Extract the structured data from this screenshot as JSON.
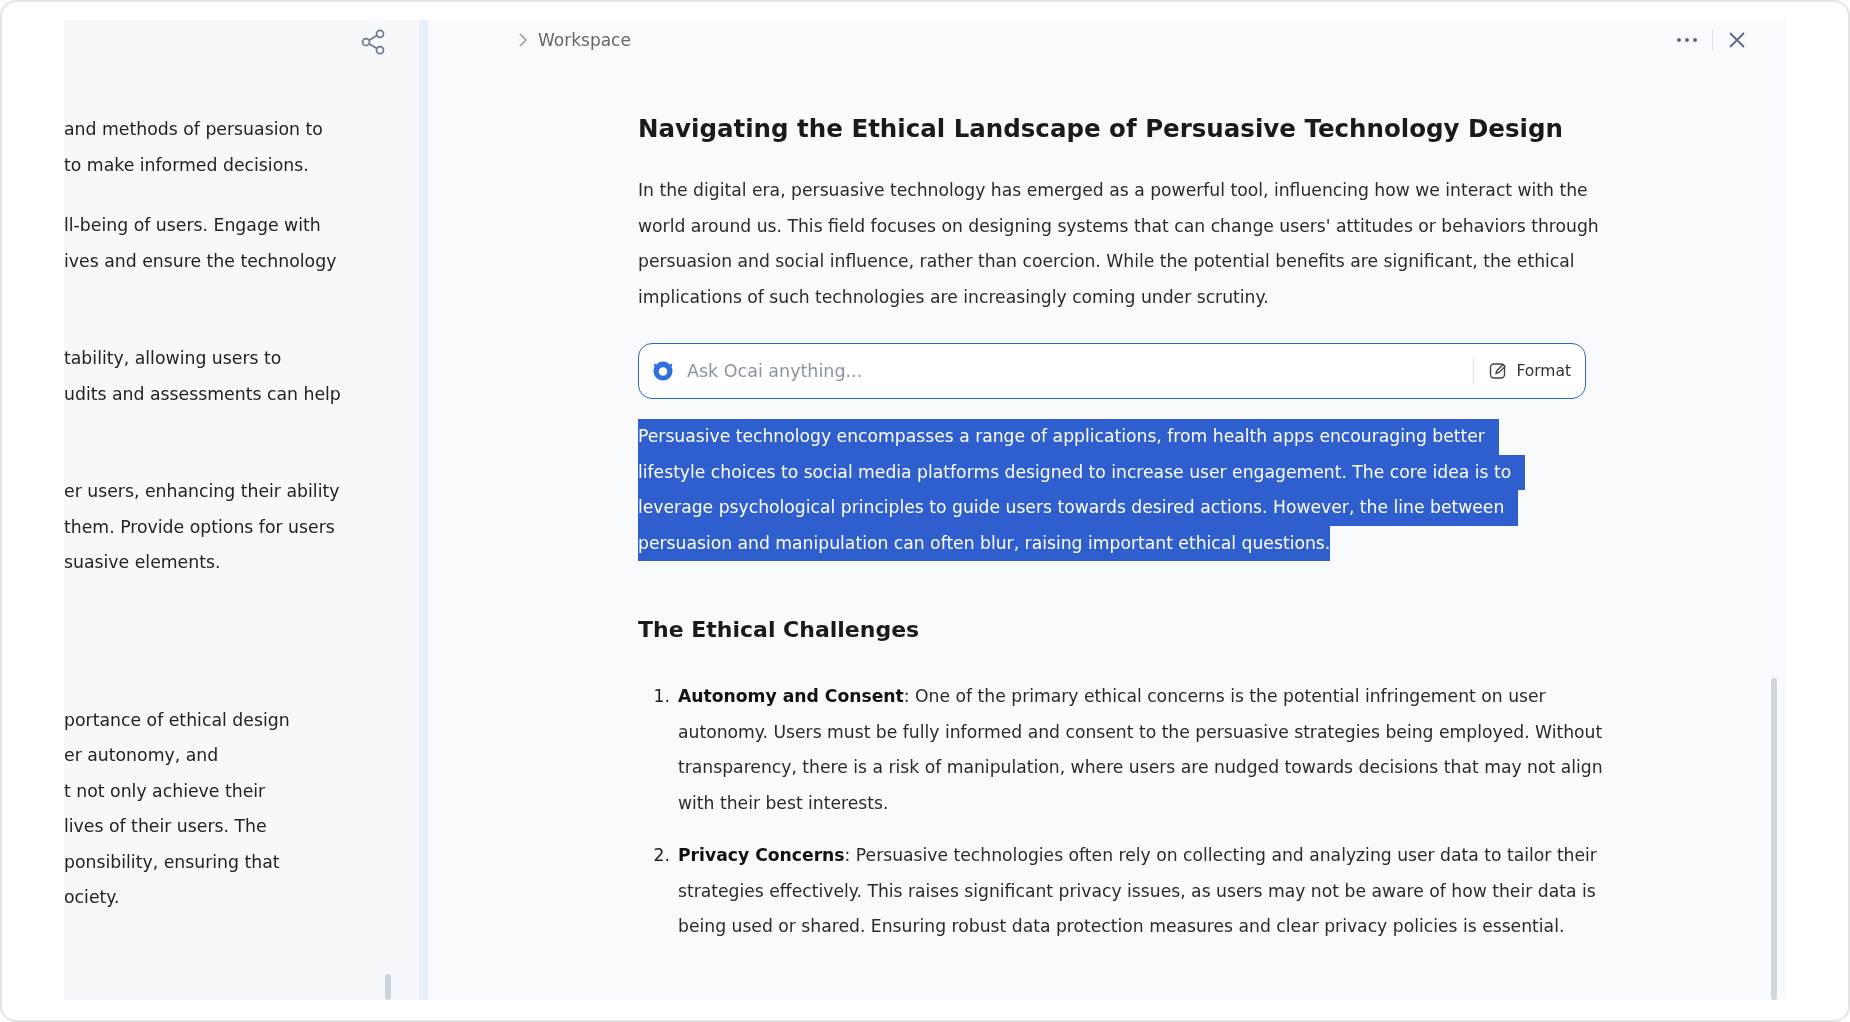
{
  "side_panel": {
    "paragraphs": [
      {
        "lines": [
          "and methods of persuasion to",
          "to make informed decisions."
        ]
      },
      {
        "lines": [
          "ll-being of users. Engage with",
          "ives and ensure the technology"
        ]
      },
      {
        "lines": [
          "tability, allowing users to",
          "udits and assessments can help"
        ]
      },
      {
        "lines": [
          "er users, enhancing their ability",
          "them. Provide options for users",
          "suasive elements."
        ]
      },
      {
        "lines": [
          "portance of ethical design",
          "er autonomy, and",
          "t not only achieve their",
          "lives of their users. The",
          "ponsibility, ensuring that",
          "ociety."
        ]
      }
    ]
  },
  "breadcrumb": [
    "Workspace"
  ],
  "document": {
    "title": "Navigating the Ethical Landscape of Persuasive Technology Design",
    "intro": "In the digital era, persuasive technology has emerged as a powerful tool, influencing how we interact with the world around us. This field focuses on designing systems that can change users' attitudes or behaviors through persuasion and social influence, rather than coercion. While the potential benefits are significant, the ethical implications of such technologies are increasingly coming under scrutiny.",
    "ask": {
      "placeholder": "Ask Ocai anything...",
      "format_label": "Format"
    },
    "selected_paragraph": {
      "lines": [
        "Persuasive technology encompasses a range of applications, from health apps encouraging better",
        "lifestyle choices to social media platforms designed to increase user engagement. The core idea is to",
        "leverage psychological principles to guide users towards desired actions. However, the line between",
        "persuasion and manipulation can often blur, raising important ethical questions."
      ],
      "selected": true
    },
    "heading": "The Ethical Challenges",
    "list": [
      {
        "number": "1.",
        "text": "**Autonomy and Consent**: One of the primary ethical concerns is the potential infringement on user autonomy. Users must be fully informed and consent to the persuasive strategies being employed. Without transparency, there is a risk of manipulation, where users are nudged towards decisions that may not align with their best interests."
      },
      {
        "number": "2.",
        "text": "**Privacy Concerns**: Persuasive technologies often rely on collecting and analyzing user data to tailor their strategies effectively. This raises significant privacy issues, as users may not be aware of how their data is being used or shared. Ensuring robust data protection measures and clear privacy policies is essential."
      }
    ]
  }
}
